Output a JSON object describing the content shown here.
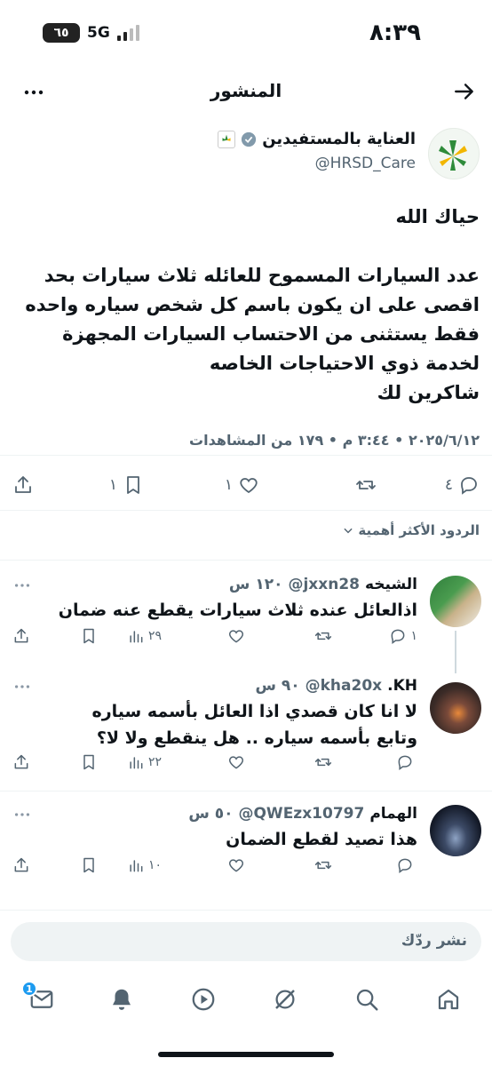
{
  "status_bar": {
    "time": "٨:٣٩",
    "battery": "٦٥",
    "network": "5G"
  },
  "header": {
    "title": "المنشور"
  },
  "author": {
    "name": "العناية بالمستفيدين",
    "handle": "@HRSD_Care"
  },
  "post": {
    "text": "حياك الله\n\nعدد السيارات المسموح للعائله ثلاث سيارات بحد اقصى على ان يكون باسم كل شخص سياره واحده فقط يستثنى من الاحتساب السيارات المجهزة لخدمة ذوي الاحتياجات الخاصه\nشاكرين لك",
    "meta": "٢٠٢٥/٦/١٢ • ٣:٤٤ م • ١٧٩ من المشاهدات",
    "replies": "٤",
    "reposts": "",
    "likes": "١",
    "bookmarks": "١"
  },
  "sort": {
    "label": "الردود الأكثر أهمية"
  },
  "replies": [
    {
      "name": "الشيخه",
      "handle": "@jxxn28",
      "time": "١٢٠ س",
      "text": "اذالعائل عنده ثلاث سيارات يقطع عنه ضمان",
      "replies": "١",
      "views": "٢٩"
    },
    {
      "name": "KH.",
      "handle": "@kha20x",
      "time": "٩٠ س",
      "text": "لا انا كان قصدي اذا العائل بأسمه سياره\nوتابع بأسمه سياره .. هل ينقطع ولا لا؟",
      "replies": "",
      "views": "٢٢"
    },
    {
      "name": "الهمام",
      "handle": "@QWEzx10797",
      "time": "٥٠ س",
      "text": "هذا تصيد لقطع الضمان",
      "replies": "",
      "views": "١٠"
    }
  ],
  "compose": {
    "placeholder": "نشر ردّك"
  },
  "tab_bar": {
    "messages_badge": "1"
  },
  "colors": {
    "accent": "#1d9bf0",
    "secondary_text": "#536471",
    "divider": "#eff3f4"
  }
}
